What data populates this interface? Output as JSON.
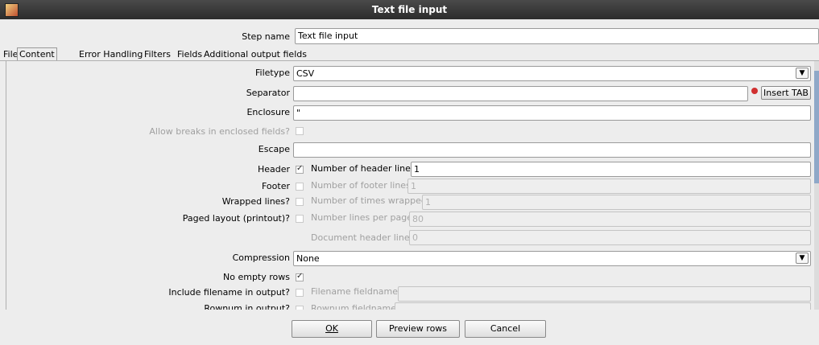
{
  "window": {
    "title": "Text file input"
  },
  "step": {
    "label": "Step name",
    "value": "Text file input"
  },
  "tabs": [
    "File",
    "Content",
    "Error Handling",
    "Filters",
    "Fields",
    "Additional output fields"
  ],
  "content": {
    "filetype": {
      "label": "Filetype",
      "value": "CSV"
    },
    "separator": {
      "label": "Separator",
      "value": "",
      "insert_tab": "Insert TAB"
    },
    "enclosure": {
      "label": "Enclosure",
      "value": "\""
    },
    "allow_breaks": {
      "label": "Allow breaks in enclosed fields?",
      "checked": false
    },
    "escape": {
      "label": "Escape",
      "value": ""
    },
    "header": {
      "label": "Header",
      "checked": true,
      "lines_label": "Number of header lines",
      "lines_value": "1"
    },
    "footer": {
      "label": "Footer",
      "checked": false,
      "lines_label": "Number of footer lines",
      "lines_value": "1"
    },
    "wrapped": {
      "label": "Wrapped lines?",
      "checked": false,
      "times_label": "Number of times wrapped",
      "times_value": "1"
    },
    "paged": {
      "label": "Paged layout (printout)?",
      "checked": false,
      "lines_label": "Number lines per page",
      "lines_value": "80",
      "doc_header_label": "Document header lines",
      "doc_header_value": "0"
    },
    "compression": {
      "label": "Compression",
      "value": "None"
    },
    "no_empty_rows": {
      "label": "No empty rows",
      "checked": true
    },
    "include_filename": {
      "label": "Include filename in output?",
      "checked": false,
      "field_label": "Filename fieldname",
      "field_value": ""
    },
    "rownum": {
      "label": "Rownum in output?",
      "checked": false,
      "field_label": "Rownum fieldname"
    }
  },
  "buttons": {
    "ok": "OK",
    "preview": "Preview rows",
    "cancel": "Cancel"
  }
}
